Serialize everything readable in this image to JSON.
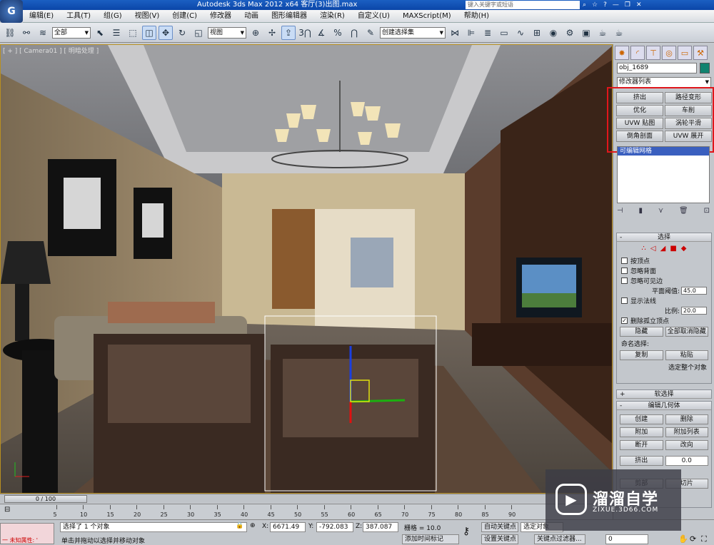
{
  "titlebar": {
    "title": "Autodesk 3ds Max  2012 x64    客厅(3)出图.max",
    "search_placeholder": "键入关键字或短语"
  },
  "menubar": [
    "编辑(E)",
    "工具(T)",
    "组(G)",
    "视图(V)",
    "创建(C)",
    "修改器",
    "动画",
    "图形编辑器",
    "渲染(R)",
    "自定义(U)",
    "MAXScript(M)",
    "帮助(H)"
  ],
  "toolbar": {
    "selection_filter": "全部",
    "reference_coord": "视图",
    "named_selection": "创建选择集",
    "snap_label": "3"
  },
  "viewport": {
    "label": "[ + ] [ Camera01 ] [ 明暗处理 ]"
  },
  "command_panel": {
    "object_name": "obj_1689",
    "modifier_list": "修改器列表",
    "modifier_buttons": [
      "挤出",
      "路径变形",
      "优化",
      "车削",
      "UVW 贴图",
      "涡轮平滑",
      "倒角剖面",
      "UVW 展开"
    ],
    "stack_item": "可编辑网格",
    "selection": {
      "title": "选择",
      "by_vertex": "按顶点",
      "ignore_backfacing": "忽略背面",
      "ignore_visible_edges": "忽略可见边",
      "planar_threshold_label": "平面阈值:",
      "planar_threshold": "45.0",
      "show_normals": "显示法线",
      "scale_label": "比例:",
      "scale": "20.0",
      "delete_isolated": "删除孤立顶点",
      "hide": "隐藏",
      "unhide_all": "全部取消隐藏",
      "named_selections": "命名选择:",
      "copy": "复制",
      "paste": "粘贴",
      "whole_object": "选定整个对象"
    },
    "soft_selection": "软选择",
    "edit_geometry": {
      "title": "编辑几何体",
      "create": "创建",
      "delete": "删除",
      "attach": "附加",
      "attach_list": "附加列表",
      "detach": "断开",
      "turn": "改向",
      "extrude": "挤出",
      "extrude_val": "0.0",
      "slice": "切片",
      "cut": "剪部"
    }
  },
  "timeline": {
    "frame_display": "0 / 100",
    "ticks": [
      "5",
      "10",
      "15",
      "20",
      "25",
      "30",
      "35",
      "40",
      "45",
      "50",
      "55",
      "60",
      "65",
      "70",
      "75",
      "80",
      "85",
      "90"
    ]
  },
  "statusbar": {
    "unknown_attr": "一 未知属性: '",
    "selected_count": "选择了 1 个对象",
    "prompt": "单击并拖动以选择并移动对象",
    "x_label": "X:",
    "x": "6671.49",
    "y_label": "Y:",
    "y": "-792.083",
    "z_label": "Z:",
    "z": "387.087",
    "grid": "栅格 = 10.0",
    "add_time_tag": "添加时间标记",
    "auto_key": "自动关键点",
    "set_key": "设置关键点",
    "selected_object": "选定对象",
    "key_filters": "关键点过滤器...",
    "frame": "0"
  },
  "watermark": {
    "name": "溜溜自学",
    "url": "ZIXUE.3D66.COM"
  }
}
